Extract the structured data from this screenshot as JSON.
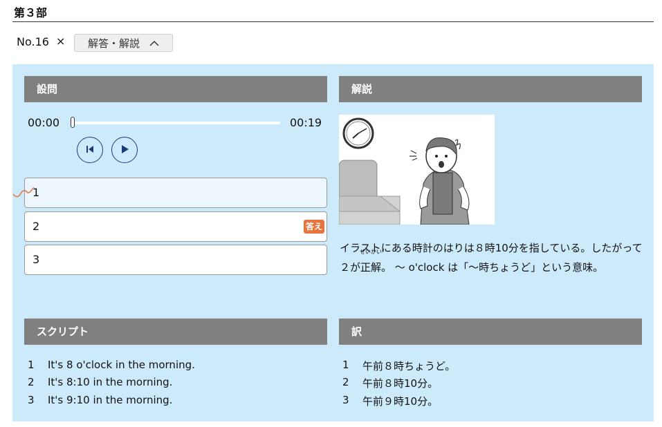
{
  "section": {
    "title": "第３部"
  },
  "question": {
    "number": "No.16",
    "close_symbol": "×",
    "toggle_label": "解答・解説",
    "toggle_icon": "chevron-up-icon"
  },
  "panels": {
    "question_header": "設問",
    "explanation_header": "解説",
    "script_header": "スクリプト",
    "translation_header": "訳"
  },
  "player": {
    "current_time": "00:00",
    "duration": "00:19",
    "progress": 0
  },
  "choices": [
    {
      "label": "1",
      "selected": true
    },
    {
      "label": "2",
      "answer_badge": "答え"
    },
    {
      "label": "3"
    }
  ],
  "explanation": {
    "text_1": "イラストにある時計のはりは８時10分を指している。したがって２が",
    "ruby_base": "正解",
    "ruby_text": "せいかい",
    "text_2": "。 ～ o'clock は「～時ちょうど」という意味。"
  },
  "script": [
    {
      "num": "1",
      "text": "It's 8 o'clock in the morning."
    },
    {
      "num": "2",
      "text": "It's 8:10 in the morning."
    },
    {
      "num": "3",
      "text": "It's 9:10 in the morning."
    }
  ],
  "translation": [
    {
      "num": "1",
      "text": "午前８時ちょうど。"
    },
    {
      "num": "2",
      "text": "午前８時10分。"
    },
    {
      "num": "3",
      "text": "午前９時10分。"
    }
  ],
  "colors": {
    "panel_bg": "#cdeafb",
    "header_bg": "#808080",
    "answer_badge": "#e8743b",
    "control_stroke": "#1d3a7a"
  }
}
